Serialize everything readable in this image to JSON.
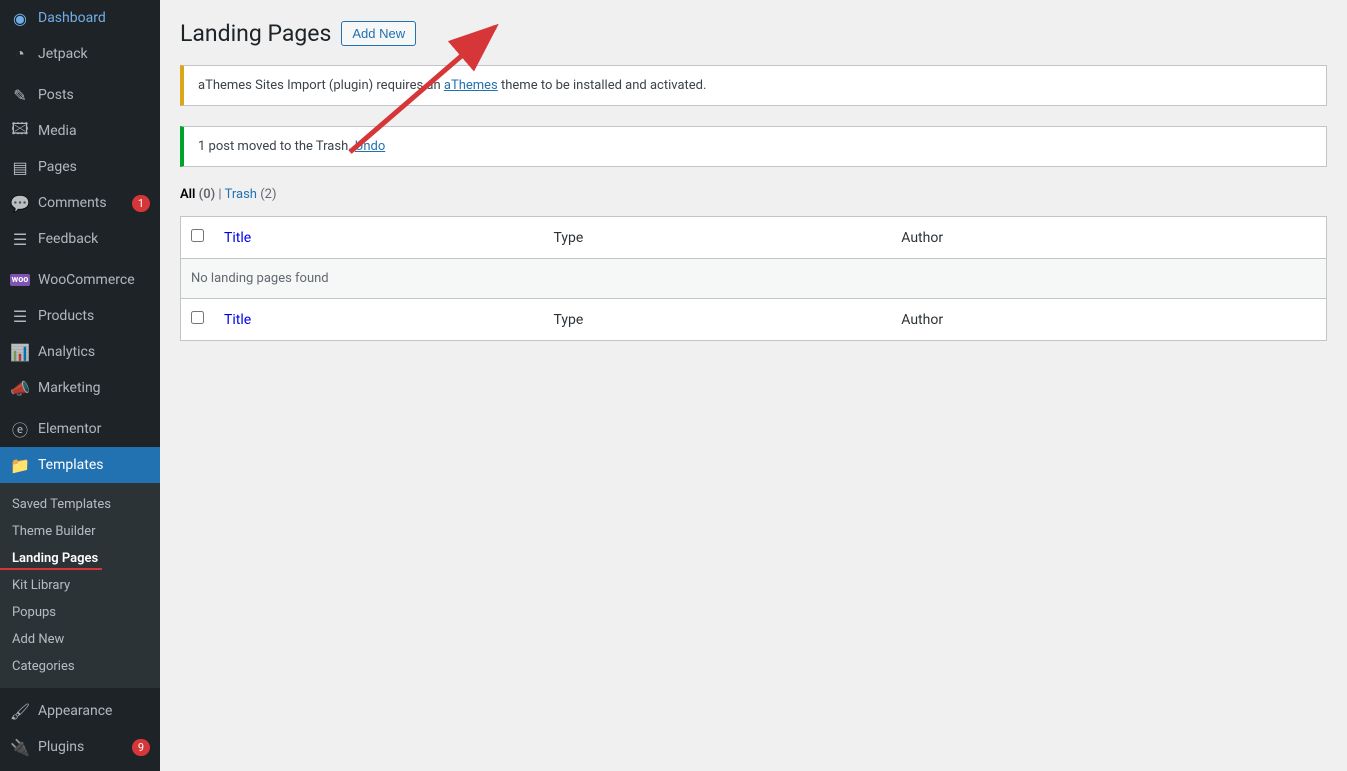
{
  "sidebar": {
    "items": [
      {
        "icon": "dashboard-icon",
        "glyph": "◉",
        "label": "Dashboard"
      },
      {
        "icon": "jetpack-icon",
        "glyph": "◔",
        "label": "Jetpack"
      }
    ],
    "items2": [
      {
        "icon": "posts-icon",
        "glyph": "✎",
        "label": "Posts"
      },
      {
        "icon": "media-icon",
        "glyph": "🖾",
        "label": "Media"
      },
      {
        "icon": "pages-icon",
        "glyph": "▤",
        "label": "Pages"
      },
      {
        "icon": "comments-icon",
        "glyph": "💬",
        "label": "Comments",
        "badge": "1"
      },
      {
        "icon": "feedback-icon",
        "glyph": "☰",
        "label": "Feedback"
      }
    ],
    "items3": [
      {
        "icon": "woocommerce-icon",
        "glyph": "woo",
        "label": "WooCommerce"
      },
      {
        "icon": "products-icon",
        "glyph": "☰",
        "label": "Products"
      },
      {
        "icon": "analytics-icon",
        "glyph": "📊",
        "label": "Analytics"
      },
      {
        "icon": "marketing-icon",
        "glyph": "📣",
        "label": "Marketing"
      }
    ],
    "items4": [
      {
        "icon": "elementor-icon",
        "glyph": "ⓔ",
        "label": "Elementor"
      },
      {
        "icon": "templates-icon",
        "glyph": "📁",
        "label": "Templates",
        "current": true
      }
    ],
    "submenu": [
      {
        "label": "Saved Templates"
      },
      {
        "label": "Theme Builder"
      },
      {
        "label": "Landing Pages",
        "current": true
      },
      {
        "label": "Kit Library"
      },
      {
        "label": "Popups"
      },
      {
        "label": "Add New"
      },
      {
        "label": "Categories"
      }
    ],
    "items5": [
      {
        "icon": "appearance-icon",
        "glyph": "🖌",
        "label": "Appearance"
      },
      {
        "icon": "plugins-icon",
        "glyph": "🔌",
        "label": "Plugins",
        "badge": "9"
      }
    ]
  },
  "header": {
    "title": "Landing Pages",
    "add_new": "Add New"
  },
  "notices": {
    "warning_pre": "aThemes Sites Import (plugin) requires an ",
    "warning_link": "aThemes",
    "warning_post": " theme to be installed and activated.",
    "success_pre": "1 post moved to the Trash. ",
    "success_link": "Undo"
  },
  "filters": {
    "all_label": "All",
    "all_count": "(0)",
    "sep": " | ",
    "trash_label": "Trash",
    "trash_count": "(2)"
  },
  "table": {
    "col_title": "Title",
    "col_type": "Type",
    "col_author": "Author",
    "empty": "No landing pages found"
  }
}
